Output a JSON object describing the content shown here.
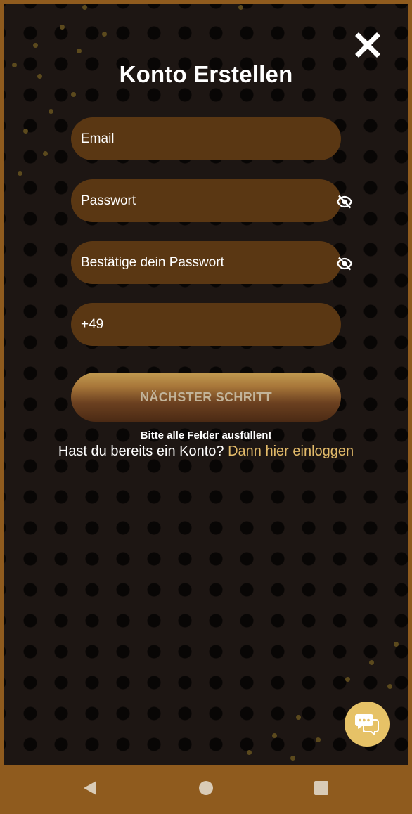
{
  "form": {
    "title": "Konto Erstellen",
    "email_placeholder": "Email",
    "password_placeholder": "Passwort",
    "confirm_password_placeholder": "Bestätige dein Passwort",
    "phone_value": "+49",
    "next_button_label": "NÄCHSTER SCHRITT",
    "hint_text": "Bitte alle Felder ausfüllen!",
    "have_account_text": "Hast du bereits ein Konto?",
    "login_link_text": "Dann hier einloggen"
  },
  "icons": {
    "close": "close-icon",
    "password_visibility": "eye-off-icon",
    "chat": "chat-bubbles-icon",
    "nav_back": "triangle-back-icon",
    "nav_home": "circle-home-icon",
    "nav_recent": "square-recents-icon"
  },
  "colors": {
    "frame": "#8f5b1e",
    "background": "#1d1613",
    "field": "#5a3713",
    "accent_link": "#e3bb6a",
    "chat_button": "#e6c267"
  }
}
